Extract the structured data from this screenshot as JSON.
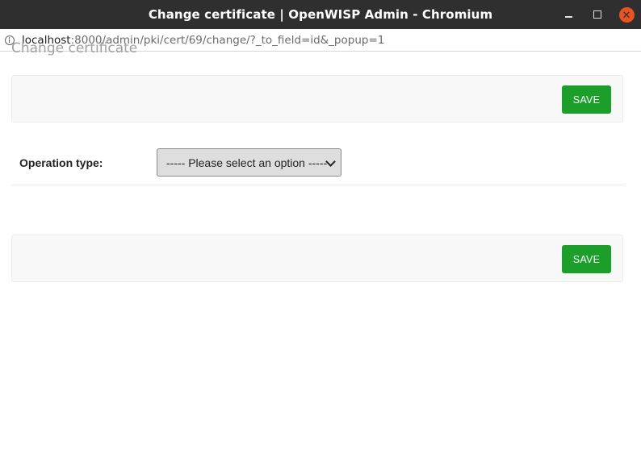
{
  "window": {
    "title": "Change certificate | OpenWISP Admin - Chromium"
  },
  "address_bar": {
    "host": "localhost",
    "path": ":8000/admin/pki/cert/69/change/?_to_field=id&_popup=1"
  },
  "page": {
    "heading": "Change certificate"
  },
  "toolbar": {
    "save_label": "SAVE"
  },
  "form": {
    "operation_type_label": "Operation type:",
    "operation_type_selected": "----- Please select an option -----"
  },
  "icons": {
    "info": "info-icon",
    "minimize": "minimize-icon",
    "maximize": "maximize-icon",
    "close": "close-icon",
    "dropdown": "chevron-down-icon"
  },
  "colors": {
    "titlebar": "#2f2f2f",
    "close_button": "#e95420",
    "save_button": "#1b9e2a"
  }
}
